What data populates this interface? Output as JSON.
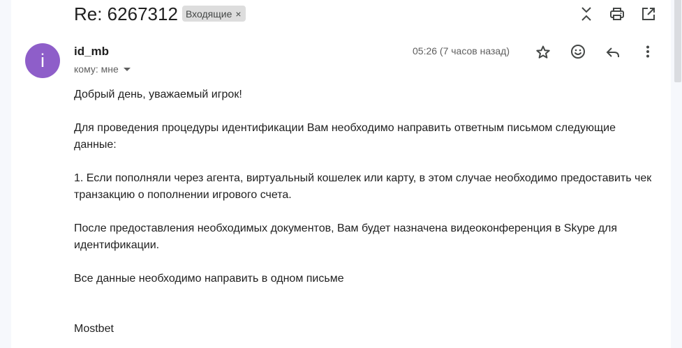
{
  "email": {
    "subject": "Re: 6267312",
    "label": "Входящие",
    "label_remove": "×",
    "sender": {
      "initial": "i",
      "name": "id_mb",
      "avatar_color": "#8e5ec9"
    },
    "recipient": "кому: мне",
    "timestamp": "05:26 (7 часов назад)",
    "body": {
      "greeting": "Добрый день, уважаемый игрок!",
      "paragraph1": "Для проведения процедуры идентификации Вам необходимо направить ответным письмом следующие данные:",
      "item1": "1. Если пополняли через агента, виртуальный кошелек или карту, в этом случае необходимо предоставить чек транзакцию о пополнении игрового счета.",
      "paragraph2": "После предоставления необходимых документов, Вам будет назначена видеоконференция в Skype для идентификации.",
      "paragraph3": "Все данные необходимо направить в одном письме",
      "signature": "Mostbet"
    }
  },
  "toolbar": {
    "icons": [
      "collapse-all-icon",
      "print-icon",
      "open-in-new-window-icon"
    ]
  },
  "message_actions": {
    "icons": [
      "star-icon",
      "emoji-reaction-icon",
      "reply-icon",
      "more-vert-icon"
    ]
  },
  "colors": {
    "background": "#f6f8fc",
    "pane": "#ffffff",
    "chip": "#dddddd",
    "icon": "#444746"
  }
}
